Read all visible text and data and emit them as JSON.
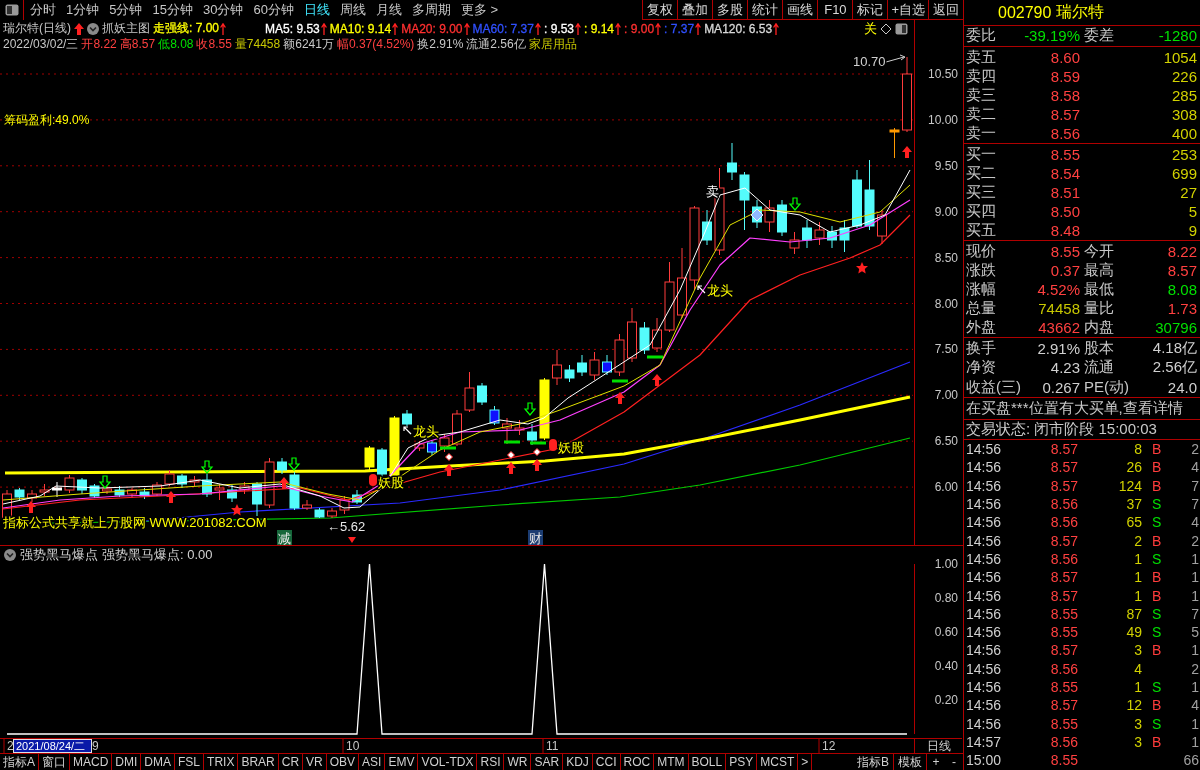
{
  "toolbar": {
    "periods": [
      {
        "label": "分时",
        "selected": false
      },
      {
        "label": "1分钟",
        "selected": false
      },
      {
        "label": "5分钟",
        "selected": false
      },
      {
        "label": "15分钟",
        "selected": false
      },
      {
        "label": "30分钟",
        "selected": false
      },
      {
        "label": "60分钟",
        "selected": false
      },
      {
        "label": "日线",
        "selected": true
      },
      {
        "label": "周线",
        "selected": false
      },
      {
        "label": "月线",
        "selected": false
      },
      {
        "label": "多周期",
        "selected": false
      },
      {
        "label": "更多 >",
        "selected": false
      }
    ],
    "actions": [
      "复权",
      "叠加",
      "多股",
      "统计",
      "画线",
      "F10",
      "标记",
      "+自选",
      "返回"
    ]
  },
  "main_chart": {
    "title": "瑞尔特(日线)",
    "indicator": "抓妖主图",
    "legend": [
      {
        "label": "走强线:",
        "value": "7.00",
        "color": "#ffff00"
      },
      {
        "label": "MA5:",
        "value": "9.53",
        "color": "#ffffff"
      },
      {
        "label": "MA10:",
        "value": "9.14",
        "color": "#ffff00"
      },
      {
        "label": "MA20:",
        "value": "9.00",
        "color": "#ff3030"
      },
      {
        "label": "MA60:",
        "value": "7.37",
        "color": "#3050ff"
      },
      {
        "label": ":",
        "value": "9.53",
        "color": "#ffffff"
      },
      {
        "label": ":",
        "value": "9.14",
        "color": "#ffff00"
      },
      {
        "label": ":",
        "value": "9.00",
        "color": "#ff3030"
      },
      {
        "label": ":",
        "value": "7.37",
        "color": "#3050ff"
      },
      {
        "label": "MA120:",
        "value": "6.53",
        "color": "#d8d8d8"
      }
    ],
    "close_label": "关",
    "bar_info": {
      "date": "2022/03/02/三",
      "fields": [
        {
          "label": "开",
          "value": "8.22",
          "color": "#ff4040"
        },
        {
          "label": "高",
          "value": "8.57",
          "color": "#ff4040"
        },
        {
          "label": "低",
          "value": "8.08",
          "color": "#00e000"
        },
        {
          "label": "收",
          "value": "8.55",
          "color": "#ff4040"
        },
        {
          "label": "量",
          "value": "74458",
          "color": "#c8c800"
        },
        {
          "label": "额",
          "value": "6241万",
          "color": "#c8c8c8"
        },
        {
          "label": "幅",
          "value": "0.37(4.52%)",
          "color": "#ff4040"
        },
        {
          "label": "换",
          "value": "2.91%",
          "color": "#c8c8c8"
        },
        {
          "label": "流通",
          "value": "2.56亿",
          "color": "#c8c8c8"
        }
      ],
      "sector": "家居用品"
    },
    "chip_profit": "筹码盈利:49.0%",
    "formula_note": "指标公式共享就上万股网 WWW.201082.COM",
    "price_axis": [
      "10.50",
      "10.00",
      "9.50",
      "9.00",
      "8.50",
      "8.00",
      "7.50",
      "7.00",
      "6.50",
      "6.00"
    ],
    "annotations": [
      {
        "kind": "peak",
        "text": "10.70"
      },
      {
        "kind": "low",
        "text": "←5.62"
      },
      {
        "kind": "sell",
        "text": "卖"
      },
      {
        "kind": "leader",
        "text": "龙头"
      },
      {
        "kind": "leader",
        "text": "龙头"
      },
      {
        "kind": "demon",
        "text": "妖股"
      },
      {
        "kind": "demon",
        "text": "妖股"
      }
    ],
    "tags": [
      {
        "kind": "exit",
        "text": "减"
      },
      {
        "kind": "wealth",
        "text": "财"
      }
    ]
  },
  "sub_chart": {
    "indicator": "强势黑马爆点",
    "readout": "强势黑马爆点: 0.00",
    "chart_data": {
      "type": "line",
      "ylim": [
        0,
        1
      ],
      "yticks": [
        {
          "value": 1,
          "label": "1.00"
        },
        {
          "value": 0.8,
          "label": "0.80"
        },
        {
          "value": 0.6,
          "label": "0.60"
        },
        {
          "value": 0.4,
          "label": "0.40"
        },
        {
          "value": 0.2,
          "label": "0.20"
        }
      ],
      "series": [
        {
          "color": "#ffffff",
          "values": [
            0,
            0,
            0,
            0,
            0,
            0,
            0,
            0,
            0,
            0,
            0,
            0,
            0,
            0,
            0,
            0,
            0,
            0,
            0,
            0,
            0,
            0,
            0,
            0,
            0,
            0,
            0,
            0,
            0,
            1,
            0,
            0,
            0,
            0,
            0,
            0,
            0,
            0,
            0,
            0,
            0,
            0,
            0,
            1,
            0,
            0,
            0,
            0,
            0,
            0,
            0,
            0,
            0,
            0,
            0,
            0,
            0,
            0,
            0,
            0,
            0,
            0,
            0,
            0,
            0,
            0,
            0,
            0,
            0,
            0,
            0,
            0,
            0
          ]
        }
      ]
    }
  },
  "x_axis": {
    "labels": [
      "2",
      "9",
      "10",
      "11",
      "12"
    ],
    "cursor_date": "2021/08/24/二",
    "period_label": "日线"
  },
  "indicator_tabs": {
    "left": [
      "指标A",
      "窗口",
      "MACD",
      "DMI",
      "DMA",
      "FSL",
      "TRIX",
      "BRAR",
      "CR",
      "VR",
      "OBV",
      "ASI",
      "EMV",
      "VOL-TDX",
      "RSI",
      "WR",
      "SAR",
      "KDJ",
      "CCI",
      "ROC",
      "MTM",
      "BOLL",
      "PSY",
      "MCST",
      ">"
    ],
    "right": [
      "指标B",
      "模板",
      "+",
      "-"
    ]
  },
  "quote": {
    "code": "002790",
    "name": "瑞尔特",
    "summary": [
      {
        "label": "委比",
        "value": "-39.19%",
        "color": "#00e000"
      },
      {
        "label": "委差",
        "value": "-1280",
        "color": "#00e000"
      }
    ],
    "asks": [
      {
        "label": "卖五",
        "price": "8.60",
        "volume": "1054"
      },
      {
        "label": "卖四",
        "price": "8.59",
        "volume": "226"
      },
      {
        "label": "卖三",
        "price": "8.58",
        "volume": "285"
      },
      {
        "label": "卖二",
        "price": "8.57",
        "volume": "308"
      },
      {
        "label": "卖一",
        "price": "8.56",
        "volume": "400"
      }
    ],
    "bids": [
      {
        "label": "买一",
        "price": "8.55",
        "volume": "253"
      },
      {
        "label": "买二",
        "price": "8.54",
        "volume": "699"
      },
      {
        "label": "买三",
        "price": "8.51",
        "volume": "27"
      },
      {
        "label": "买四",
        "price": "8.50",
        "volume": "5"
      },
      {
        "label": "买五",
        "price": "8.48",
        "volume": "9"
      }
    ],
    "stats": [
      {
        "label": "现价",
        "value": "8.55",
        "color": "#ff4040"
      },
      {
        "label": "今开",
        "value": "8.22",
        "color": "#ff4040"
      },
      {
        "label": "涨跌",
        "value": "0.37",
        "color": "#ff4040"
      },
      {
        "label": "最高",
        "value": "8.57",
        "color": "#ff4040"
      },
      {
        "label": "涨幅",
        "value": "4.52%",
        "color": "#ff4040"
      },
      {
        "label": "最低",
        "value": "8.08",
        "color": "#00e000"
      },
      {
        "label": "总量",
        "value": "74458",
        "color": "#c8c800"
      },
      {
        "label": "量比",
        "value": "1.73",
        "color": "#ff4040"
      },
      {
        "label": "外盘",
        "value": "43662",
        "color": "#ff4040"
      },
      {
        "label": "内盘",
        "value": "30796",
        "color": "#00e000"
      }
    ],
    "fundamentals": [
      {
        "label": "换手",
        "value": "2.91%"
      },
      {
        "label": "股本",
        "value": "4.18亿"
      },
      {
        "label": "净资",
        "value": "4.23"
      },
      {
        "label": "流通",
        "value": "2.56亿"
      },
      {
        "label": "收益(三)",
        "value": "0.267"
      },
      {
        "label": "PE(动)",
        "value": "24.0"
      }
    ],
    "notice": "在买盘***位置有大买单,查看详情",
    "status": "交易状态: 闭市阶段 15:00:03",
    "ticks": [
      {
        "time": "14:56",
        "price": "8.57",
        "volume": "8",
        "side": "B",
        "kind": "buy",
        "count": "2"
      },
      {
        "time": "14:56",
        "price": "8.57",
        "volume": "26",
        "side": "B",
        "kind": "buy",
        "count": "4"
      },
      {
        "time": "14:56",
        "price": "8.57",
        "volume": "124",
        "side": "B",
        "kind": "buy",
        "count": "7"
      },
      {
        "time": "14:56",
        "price": "8.56",
        "volume": "37",
        "side": "S",
        "kind": "sell",
        "count": "7"
      },
      {
        "time": "14:56",
        "price": "8.56",
        "volume": "65",
        "side": "S",
        "kind": "sell",
        "count": "4"
      },
      {
        "time": "14:56",
        "price": "8.57",
        "volume": "2",
        "side": "B",
        "kind": "buy",
        "count": "2"
      },
      {
        "time": "14:56",
        "price": "8.56",
        "volume": "1",
        "side": "S",
        "kind": "sell",
        "count": "1"
      },
      {
        "time": "14:56",
        "price": "8.57",
        "volume": "1",
        "side": "B",
        "kind": "buy",
        "count": "1"
      },
      {
        "time": "14:56",
        "price": "8.57",
        "volume": "1",
        "side": "B",
        "kind": "buy",
        "count": "1"
      },
      {
        "time": "14:56",
        "price": "8.55",
        "volume": "87",
        "side": "S",
        "kind": "sell",
        "count": "7"
      },
      {
        "time": "14:56",
        "price": "8.55",
        "volume": "49",
        "side": "S",
        "kind": "sell",
        "count": "5"
      },
      {
        "time": "14:56",
        "price": "8.57",
        "volume": "3",
        "side": "B",
        "kind": "buy",
        "count": "1"
      },
      {
        "time": "14:56",
        "price": "8.56",
        "volume": "4",
        "kind": "neutral",
        "count": "2"
      },
      {
        "time": "14:56",
        "price": "8.55",
        "volume": "1",
        "side": "S",
        "kind": "sell",
        "count": "1"
      },
      {
        "time": "14:56",
        "price": "8.57",
        "volume": "12",
        "side": "B",
        "kind": "buy",
        "count": "4"
      },
      {
        "time": "14:56",
        "price": "8.55",
        "volume": "3",
        "side": "S",
        "kind": "sell",
        "count": "1"
      },
      {
        "time": "14:57",
        "price": "8.56",
        "volume": "3",
        "side": "B",
        "kind": "buy",
        "count": "1"
      },
      {
        "time": "15:00",
        "price": "8.55",
        "kind": "neutral",
        "count": "66"
      }
    ]
  }
}
